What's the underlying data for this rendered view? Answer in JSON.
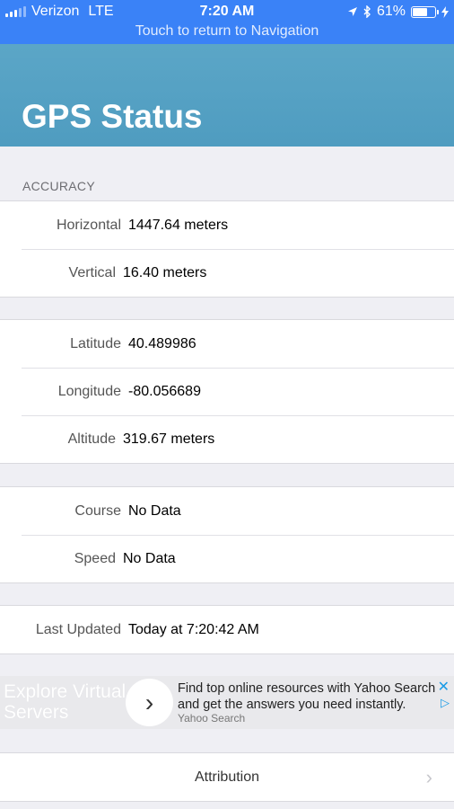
{
  "status_bar": {
    "carrier": "Verizon",
    "network": "LTE",
    "time": "7:20 AM",
    "battery": "61%",
    "return_text": "Touch to return to Navigation"
  },
  "header": {
    "title": "GPS Status"
  },
  "accuracy": {
    "section_title": "ACCURACY",
    "rows": [
      {
        "label": "Horizontal",
        "value": "1447.64 meters"
      },
      {
        "label": "Vertical",
        "value": "16.40 meters"
      }
    ]
  },
  "position": {
    "rows": [
      {
        "label": "Latitude",
        "value": "40.489986"
      },
      {
        "label": "Longitude",
        "value": "-80.056689"
      },
      {
        "label": "Altitude",
        "value": "319.67 meters"
      }
    ]
  },
  "motion": {
    "rows": [
      {
        "label": "Course",
        "value": "No Data"
      },
      {
        "label": "Speed",
        "value": "No Data"
      }
    ]
  },
  "updated": {
    "rows": [
      {
        "label": "Last Updated",
        "value": "Today at 7:20:42 AM"
      }
    ]
  },
  "ad": {
    "left_line1": "Explore Virtual",
    "left_line2": "Servers",
    "text": "Find top online resources with Yahoo Search and get the answers you need instantly.",
    "source": "Yahoo Search",
    "arrow": "›",
    "close": "✕",
    "play": "▷"
  },
  "attribution": {
    "label": "Attribution",
    "chevron": "›"
  },
  "icons": {
    "location": "location-arrow-icon",
    "bluetooth": "bluetooth-icon",
    "charging": "charging-bolt-icon"
  }
}
